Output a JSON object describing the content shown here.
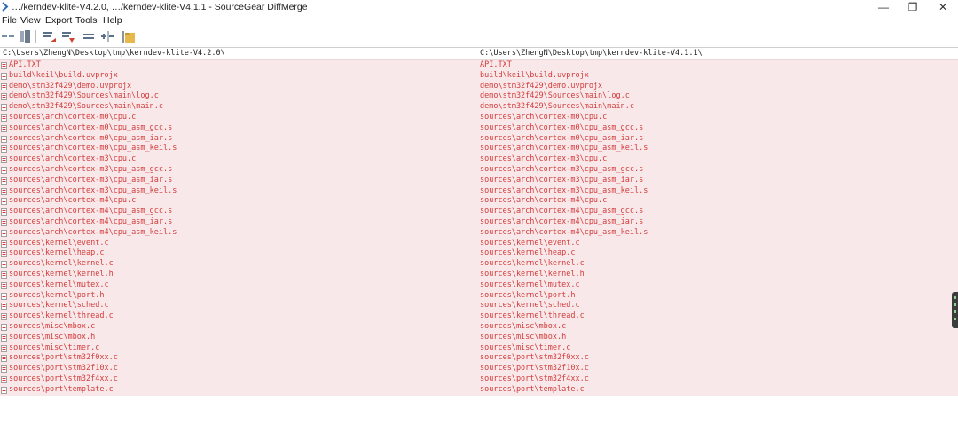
{
  "window": {
    "title": "…/kerndev-klite-V4.2.0, …/kerndev-klite-V4.1.1 - SourceGear DiffMerge",
    "minimize_glyph": "—",
    "maximize_glyph": "❐",
    "close_glyph": "✕"
  },
  "menu": {
    "items": [
      "File",
      "View",
      "Export",
      "Tools",
      "Help"
    ]
  },
  "toolbar": {
    "icons": [
      "compare-mode-icon",
      "folder-view-icon",
      "previous-change-icon",
      "next-change-icon",
      "show-equal-icon",
      "show-diff-icon",
      "folder-open-icon"
    ]
  },
  "left_pane": {
    "path": "C:\\Users\\ZhengN\\Desktop\\tmp\\kerndev-klite-V4.2.0\\"
  },
  "right_pane": {
    "path": "C:\\Users\\ZhengN\\Desktop\\tmp\\kerndev-klite-V4.1.1\\"
  },
  "files": [
    "API.TXT",
    "build\\keil\\build.uvprojx",
    "demo\\stm32f429\\demo.uvprojx",
    "demo\\stm32f429\\Sources\\main\\log.c",
    "demo\\stm32f429\\Sources\\main\\main.c",
    "sources\\arch\\cortex-m0\\cpu.c",
    "sources\\arch\\cortex-m0\\cpu_asm_gcc.s",
    "sources\\arch\\cortex-m0\\cpu_asm_iar.s",
    "sources\\arch\\cortex-m0\\cpu_asm_keil.s",
    "sources\\arch\\cortex-m3\\cpu.c",
    "sources\\arch\\cortex-m3\\cpu_asm_gcc.s",
    "sources\\arch\\cortex-m3\\cpu_asm_iar.s",
    "sources\\arch\\cortex-m3\\cpu_asm_keil.s",
    "sources\\arch\\cortex-m4\\cpu.c",
    "sources\\arch\\cortex-m4\\cpu_asm_gcc.s",
    "sources\\arch\\cortex-m4\\cpu_asm_iar.s",
    "sources\\arch\\cortex-m4\\cpu_asm_keil.s",
    "sources\\kernel\\event.c",
    "sources\\kernel\\heap.c",
    "sources\\kernel\\kernel.c",
    "sources\\kernel\\kernel.h",
    "sources\\kernel\\mutex.c",
    "sources\\kernel\\port.h",
    "sources\\kernel\\sched.c",
    "sources\\kernel\\thread.c",
    "sources\\misc\\mbox.c",
    "sources\\misc\\mbox.h",
    "sources\\misc\\timer.c",
    "sources\\port\\stm32f0xx.c",
    "sources\\port\\stm32f10x.c",
    "sources\\port\\stm32f4xx.c",
    "sources\\port\\template.c"
  ],
  "colors": {
    "diff_row_bg": "#f9e8e9",
    "diff_text": "#d33b3b",
    "header_text": "#222222"
  }
}
